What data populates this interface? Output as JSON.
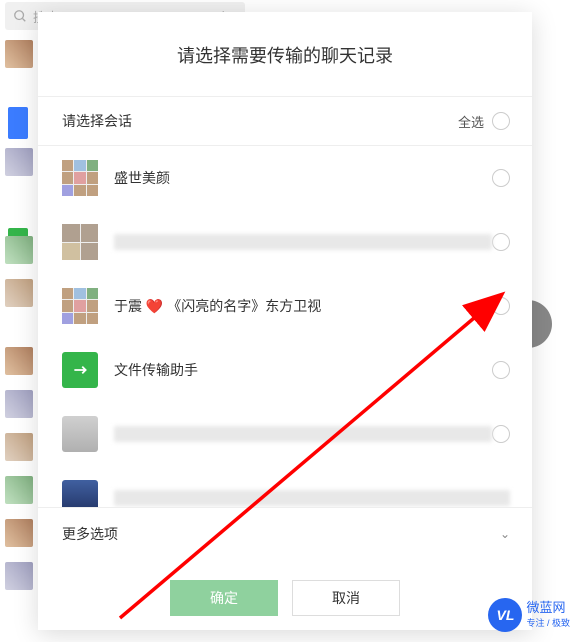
{
  "search": {
    "placeholder": "搜索"
  },
  "modal": {
    "title": "请选择需要传输的聊天记录",
    "select_session_label": "请选择会话",
    "select_all_label": "全选",
    "chats": [
      {
        "name": "盛世美颜",
        "avatar_type": "grid9",
        "blurred": false
      },
      {
        "name": "",
        "avatar_type": "grid4",
        "blurred": true
      },
      {
        "name": "于震 ❤️ 《闪亮的名字》东方卫视",
        "avatar_type": "grid9",
        "blurred": false
      },
      {
        "name": "文件传输助手",
        "avatar_type": "file",
        "blurred": false
      },
      {
        "name": "",
        "avatar_type": "single",
        "blurred": true
      },
      {
        "name": "",
        "avatar_type": "single2",
        "blurred": true
      }
    ],
    "more_options_label": "更多选项",
    "confirm_label": "确定",
    "cancel_label": "取消"
  },
  "watermark": {
    "logo_text": "VL",
    "brand": "微蓝网",
    "sub": "专注 / 极致"
  }
}
